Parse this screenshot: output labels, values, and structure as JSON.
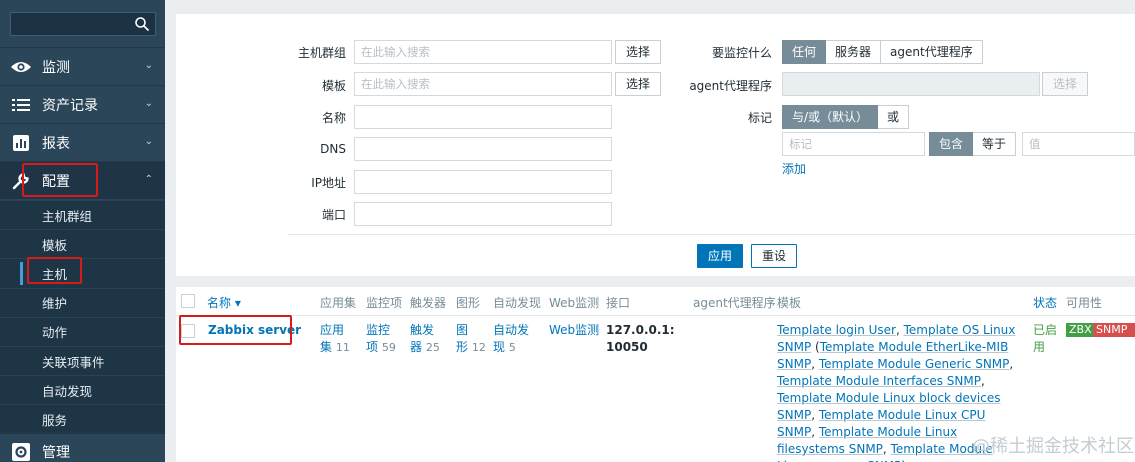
{
  "sidebar": {
    "search_placeholder": "",
    "nav": [
      {
        "label": "监测",
        "icon": "eye-icon"
      },
      {
        "label": "资产记录",
        "icon": "list-icon"
      },
      {
        "label": "报表",
        "icon": "bar-chart-icon"
      },
      {
        "label": "配置",
        "icon": "wrench-icon"
      },
      {
        "label": "管理",
        "icon": "gear-icon"
      }
    ],
    "submenu": [
      "主机群组",
      "模板",
      "主机",
      "维护",
      "动作",
      "关联项事件",
      "自动发现",
      "服务"
    ]
  },
  "filter": {
    "host_groups_label": "主机群组",
    "host_groups_placeholder": "在此输入搜索",
    "select_label": "选择",
    "templates_label": "模板",
    "templates_placeholder": "在此输入搜索",
    "name_label": "名称",
    "dns_label": "DNS",
    "ip_label": "IP地址",
    "port_label": "端口",
    "monitored_by_label": "要监控什么",
    "monitored_by_options": [
      "任何",
      "服务器",
      "agent代理程序"
    ],
    "proxy_label": "agent代理程序",
    "proxy_select_label": "选择",
    "tags_label": "标记",
    "tags_mode_options": [
      "与/或（默认）",
      "或"
    ],
    "tag_placeholder": "标记",
    "tag_op_options": [
      "包含",
      "等于"
    ],
    "value_placeholder": "值",
    "add_label": "添加",
    "apply_label": "应用",
    "reset_label": "重设"
  },
  "table": {
    "headers": {
      "name": "名称 ▾",
      "applications": "应用集",
      "items": "监控项",
      "triggers": "触发器",
      "graphs": "图形",
      "discovery": "自动发现",
      "web": "Web监测",
      "interface": "接口",
      "proxy": "agent代理程序",
      "templates": "模板",
      "status": "状态",
      "availability": "可用性"
    },
    "row": {
      "name": "Zabbix server",
      "applications_line1": "应用",
      "applications_line2": "集",
      "applications_count": "11",
      "items_line1": "监控",
      "items_line2": "项",
      "items_count": "59",
      "triggers_line1": "触发",
      "triggers_line2": "器",
      "triggers_count": "25",
      "graphs_line1": "图",
      "graphs_line2": "形",
      "graphs_count": "12",
      "discovery_line1": "自动发",
      "discovery_line2": "现",
      "discovery_count": "5",
      "web": "Web监测",
      "interface_line1": "127.0.0.1:",
      "interface_line2": "10050",
      "templates": [
        "Template login User",
        "Template OS Linux SNMP",
        "Template Module EtherLike-MIB SNMP",
        "Template Module Generic SNMP",
        "Template Module Interfaces SNMP",
        "Template Module Linux block devices SNMP",
        "Template Module Linux CPU SNMP",
        "Template Module Linux filesystems SNMP",
        "Template Module Linux memory SNMP"
      ],
      "status_line1": "已启",
      "status_line2": "用",
      "availability": [
        "ZBX",
        "SNMP"
      ]
    }
  },
  "watermark": "@稀土掘金技术社区",
  "colors": {
    "sidebar_bg": "#2b4559",
    "accent_blue": "#0275b8",
    "highlight_red": "#d61b1b",
    "status_green": "#429e47",
    "zbx_green": "#429e47",
    "snmp_red": "#d64e4e"
  }
}
